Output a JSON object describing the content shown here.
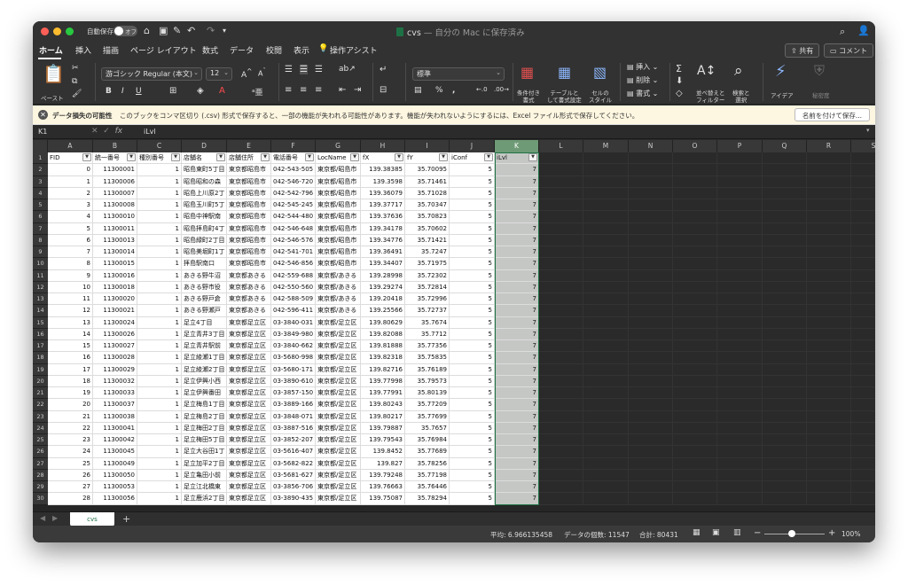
{
  "titlebar": {
    "autosave_label": "自動保存",
    "autosave_state": "オフ",
    "doc_name": "cvs",
    "doc_status": "— 自分の Mac に保存済み"
  },
  "menubar": {
    "tabs": [
      "ホーム",
      "挿入",
      "描画",
      "ページ レイアウト",
      "数式",
      "データ",
      "校閲",
      "表示",
      "操作アシスト"
    ],
    "share_label": "共有",
    "comment_label": "コメント"
  },
  "ribbon": {
    "paste_label": "ペースト",
    "font_name": "游ゴシック Regular (本文)",
    "font_size": "12",
    "number_format": "標準",
    "insert_label": "挿入",
    "delete_label": "削除",
    "format_label": "書式",
    "cond_format_label": [
      "条件付き",
      "書式"
    ],
    "table_format_label": [
      "テーブルと",
      "して書式設定"
    ],
    "cell_style_label": [
      "セルの",
      "スタイル"
    ],
    "sort_filter_label": [
      "並べ替えと",
      "フィルター"
    ],
    "find_select_label": [
      "検索と",
      "選択"
    ],
    "ideas_label": "アイデア",
    "sensitivity_label": "秘密度"
  },
  "message_bar": {
    "title": "データ損失の可能性",
    "text": "このブックをコンマ区切り (.csv) 形式で保存すると、一部の機能が失われる可能性があります。機能が失われないようにするには、Excel ファイル形式で保存してください。",
    "button": "名前を付けて保存..."
  },
  "formula_bar": {
    "name_box": "K1",
    "value": "iLvl"
  },
  "sheet": {
    "columns": [
      "A",
      "B",
      "C",
      "D",
      "E",
      "F",
      "G",
      "H",
      "I",
      "J",
      "K",
      "L",
      "M",
      "N",
      "O",
      "P",
      "Q",
      "R",
      "S"
    ],
    "selected_column": "K",
    "headers": [
      "FID",
      "統一番号",
      "種別番号",
      "店舗名",
      "店舗住所",
      "電話番号",
      "LocName",
      "fX",
      "fY",
      "iConf",
      "iLvl"
    ],
    "rows": [
      [
        "0",
        "11300001",
        "1",
        "昭島東町5丁目",
        "東京都昭島市",
        "042-543-505",
        "東京都/昭島市",
        "139.38385",
        "35.70095",
        "5",
        "7"
      ],
      [
        "1",
        "11300006",
        "1",
        "昭島昭和の森",
        "東京都昭島市",
        "042-546-720",
        "東京都/昭島市",
        "139.3598",
        "35.71461",
        "5",
        "7"
      ],
      [
        "2",
        "11300007",
        "1",
        "昭島上川原2丁",
        "東京都昭島市",
        "042-542-796",
        "東京都/昭島市",
        "139.36079",
        "35.71028",
        "5",
        "7"
      ],
      [
        "3",
        "11300008",
        "1",
        "昭島玉川町5丁",
        "東京都昭島市",
        "042-545-245",
        "東京都/昭島市",
        "139.37717",
        "35.70347",
        "5",
        "7"
      ],
      [
        "4",
        "11300010",
        "1",
        "昭島中神駅南",
        "東京都昭島市",
        "042-544-480",
        "東京都/昭島市",
        "139.37636",
        "35.70823",
        "5",
        "7"
      ],
      [
        "5",
        "11300011",
        "1",
        "昭島拝島町4丁",
        "東京都昭島市",
        "042-546-648",
        "東京都/昭島市",
        "139.34178",
        "35.70602",
        "5",
        "7"
      ],
      [
        "6",
        "11300013",
        "1",
        "昭島緑町2丁目",
        "東京都昭島市",
        "042-546-576",
        "東京都/昭島市",
        "139.34776",
        "35.71421",
        "5",
        "7"
      ],
      [
        "7",
        "11300014",
        "1",
        "昭島美堀町1丁",
        "東京都昭島市",
        "042-541-701",
        "東京都/昭島市",
        "139.36491",
        "35.7247",
        "5",
        "7"
      ],
      [
        "8",
        "11300015",
        "1",
        "拝島駅南口",
        "東京都昭島市",
        "042-546-856",
        "東京都/昭島市",
        "139.34407",
        "35.71975",
        "5",
        "7"
      ],
      [
        "9",
        "11300016",
        "1",
        "あきる野牛沼",
        "東京都あきる",
        "042-559-688",
        "東京都/あきる",
        "139.28998",
        "35.72302",
        "5",
        "7"
      ],
      [
        "10",
        "11300018",
        "1",
        "あきる野市役",
        "東京都あきる",
        "042-550-560",
        "東京都/あきる",
        "139.29274",
        "35.72814",
        "5",
        "7"
      ],
      [
        "11",
        "11300020",
        "1",
        "あきる野戸倉",
        "東京都あきる",
        "042-588-509",
        "東京都/あきる",
        "139.20418",
        "35.72996",
        "5",
        "7"
      ],
      [
        "12",
        "11300021",
        "1",
        "あきる野瀬戸",
        "東京都あきる",
        "042-596-411",
        "東京都/あきる",
        "139.25566",
        "35.72737",
        "5",
        "7"
      ],
      [
        "13",
        "11300024",
        "1",
        "足立4丁目",
        "東京都足立区",
        "03-3840-031",
        "東京都/足立区",
        "139.80629",
        "35.7674",
        "5",
        "7"
      ],
      [
        "14",
        "11300026",
        "1",
        "足立青井3丁目",
        "東京都足立区",
        "03-3849-980",
        "東京都/足立区",
        "139.82088",
        "35.7712",
        "5",
        "7"
      ],
      [
        "15",
        "11300027",
        "1",
        "足立青井駅前",
        "東京都足立区",
        "03-3840-662",
        "東京都/足立区",
        "139.81888",
        "35.77356",
        "5",
        "7"
      ],
      [
        "16",
        "11300028",
        "1",
        "足立綾瀬1丁目",
        "東京都足立区",
        "03-5680-998",
        "東京都/足立区",
        "139.82318",
        "35.75835",
        "5",
        "7"
      ],
      [
        "17",
        "11300029",
        "1",
        "足立綾瀬2丁目",
        "東京都足立区",
        "03-5680-171",
        "東京都/足立区",
        "139.82716",
        "35.76189",
        "5",
        "7"
      ],
      [
        "18",
        "11300032",
        "1",
        "足立伊興小西",
        "東京都足立区",
        "03-3890-610",
        "東京都/足立区",
        "139.77998",
        "35.79573",
        "5",
        "7"
      ],
      [
        "19",
        "11300033",
        "1",
        "足立伊興番田",
        "東京都足立区",
        "03-3857-150",
        "東京都/足立区",
        "139.77991",
        "35.80139",
        "5",
        "7"
      ],
      [
        "20",
        "11300037",
        "1",
        "足立梅島1丁目",
        "東京都足立区",
        "03-3889-166",
        "東京都/足立区",
        "139.80243",
        "35.77209",
        "5",
        "7"
      ],
      [
        "21",
        "11300038",
        "1",
        "足立梅島2丁目",
        "東京都足立区",
        "03-3848-071",
        "東京都/足立区",
        "139.80217",
        "35.77699",
        "5",
        "7"
      ],
      [
        "22",
        "11300041",
        "1",
        "足立梅田2丁目",
        "東京都足立区",
        "03-3887-516",
        "東京都/足立区",
        "139.79887",
        "35.7657",
        "5",
        "7"
      ],
      [
        "23",
        "11300042",
        "1",
        "足立梅田5丁目",
        "東京都足立区",
        "03-3852-207",
        "東京都/足立区",
        "139.79543",
        "35.76984",
        "5",
        "7"
      ],
      [
        "24",
        "11300045",
        "1",
        "足立大谷田1丁",
        "東京都足立区",
        "03-5616-407",
        "東京都/足立区",
        "139.8452",
        "35.77689",
        "5",
        "7"
      ],
      [
        "25",
        "11300049",
        "1",
        "足立加平2丁目",
        "東京都足立区",
        "03-5682-822",
        "東京都/足立区",
        "139.827",
        "35.78256",
        "5",
        "7"
      ],
      [
        "26",
        "11300050",
        "1",
        "足立亀田小前",
        "東京都足立区",
        "03-5681-627",
        "東京都/足立区",
        "139.79248",
        "35.77198",
        "5",
        "7"
      ],
      [
        "27",
        "11300053",
        "1",
        "足立江北橋東",
        "東京都足立区",
        "03-3856-706",
        "東京都/足立区",
        "139.76663",
        "35.76446",
        "5",
        "7"
      ],
      [
        "28",
        "11300056",
        "1",
        "足立鹿浜2丁目",
        "東京都足立区",
        "03-3890-435",
        "東京都/足立区",
        "139.75087",
        "35.78294",
        "5",
        "7"
      ]
    ],
    "tab_name": "cvs"
  },
  "status": {
    "average": "平均: 6.966135458",
    "count": "データの個数: 11547",
    "sum": "合計: 80431",
    "zoom": "100%"
  }
}
